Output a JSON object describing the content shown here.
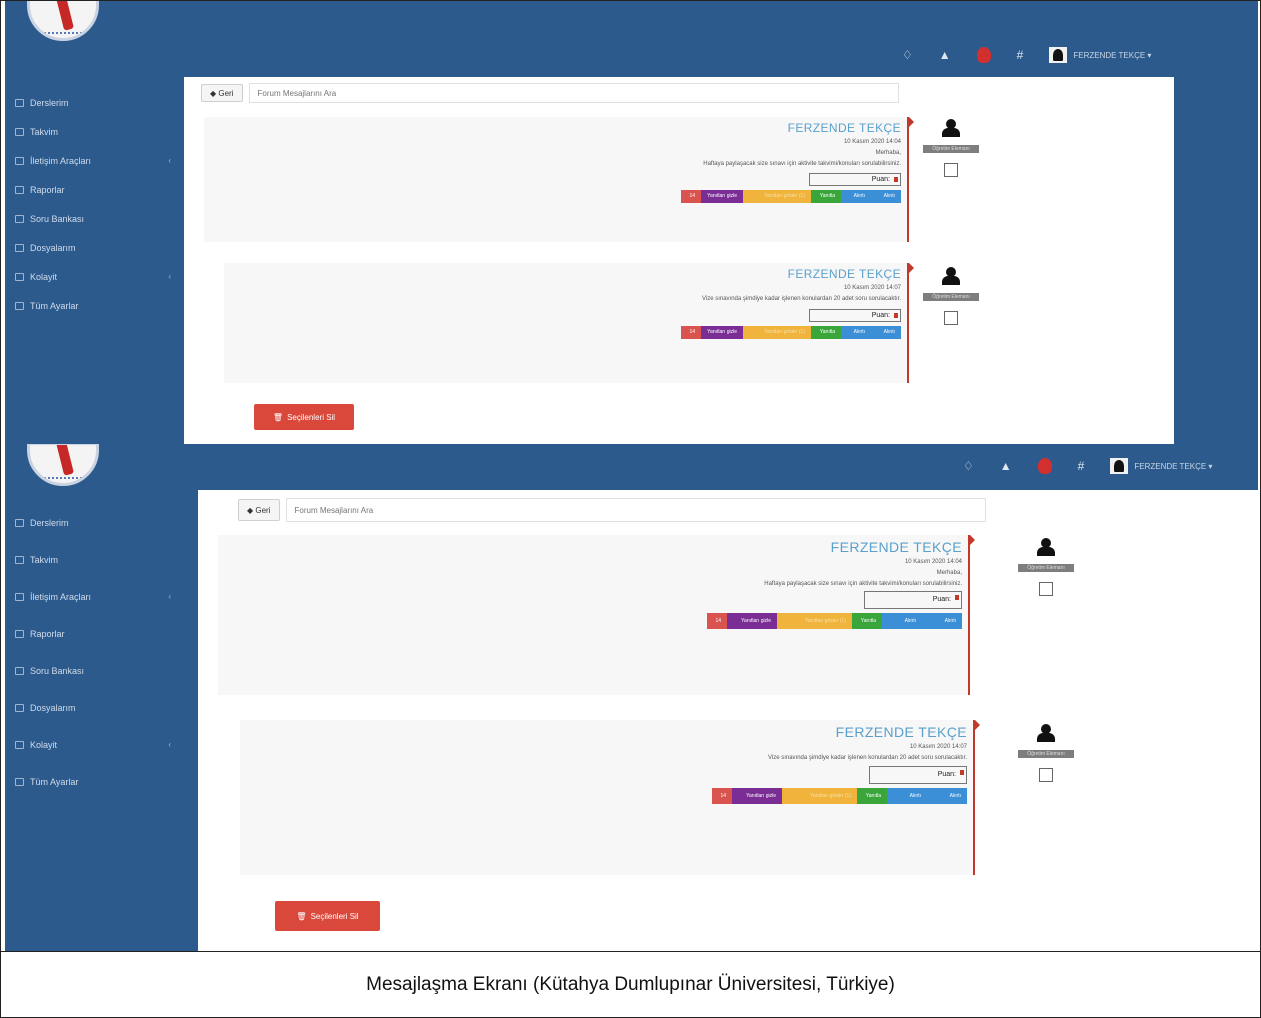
{
  "sidebar": {
    "items": [
      {
        "label": "Derslerim",
        "icon": "chart-icon",
        "has_caret": false
      },
      {
        "label": "Takvim",
        "icon": "calendar-icon",
        "has_caret": false
      },
      {
        "label": "İletişim Araçları",
        "icon": "message-icon",
        "has_caret": true
      },
      {
        "label": "Raporlar",
        "icon": "report-icon",
        "has_caret": false
      },
      {
        "label": "Soru Bankası",
        "icon": "database-icon",
        "has_caret": false
      },
      {
        "label": "Dosyalarım",
        "icon": "files-icon",
        "has_caret": false
      },
      {
        "label": "Kolayit",
        "icon": "cog-icon",
        "has_caret": true
      },
      {
        "label": "Tüm Ayarlar",
        "icon": "wrench-icon",
        "has_caret": false
      }
    ]
  },
  "header": {
    "user_name": "FERZENDE TEKÇE ▾"
  },
  "search": {
    "back_label": "◆ Geri",
    "placeholder": "Forum Mesajlarını Ara"
  },
  "posts": [
    {
      "author": "FERZENDE TEKÇE",
      "date": "10 Kasım 2020 14:04",
      "lines": [
        "Merhaba,",
        "Haftaya paylaşacak size sınavı için aktivite takvimi/konuları sorulabilirsiniz."
      ],
      "score_label": "Puan:",
      "buttons": [
        "14",
        "Yanıtları gizle",
        "Yanıtları göster (1)",
        "Yanıtla",
        "Alıntı",
        "Alıntı"
      ]
    },
    {
      "author": "FERZENDE TEKÇE",
      "date": "10 Kasım 2020 14:07",
      "lines": [
        "Vize sınavında şimdiye kadar işlenen konulardan 20 adet soru sorulacaktır."
      ],
      "score_label": "Puan:",
      "buttons": [
        "14",
        "Yanıtları gizle",
        "Yanıtları göster (1)",
        "Yanıtla",
        "Alıntı",
        "Alıntı"
      ]
    }
  ],
  "side_label": "Öğretim Elemanı",
  "delete_label": "Seçilenleri Sil",
  "caption": "Mesajlaşma Ekranı (Kütahya Dumlupınar Üniversitesi, Türkiye)",
  "colors": {
    "sidebar_bg": "#2d5a8c",
    "author": "#5aa0cc",
    "delete": "#d9483b",
    "accent_red": "#c0392b"
  }
}
